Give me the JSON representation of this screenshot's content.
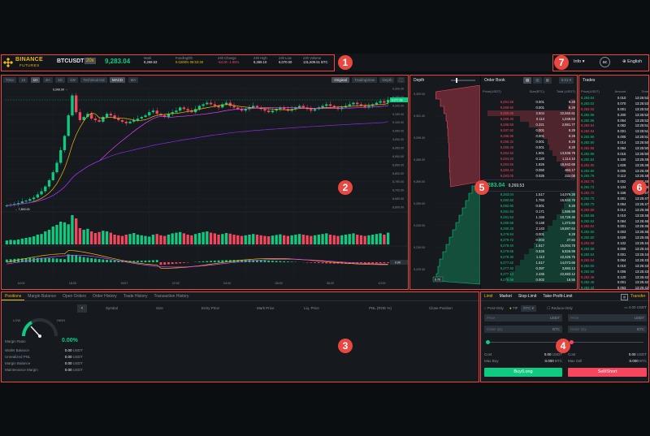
{
  "header": {
    "logo_top": "BINANCE",
    "logo_bottom": "FUTURES",
    "symbol": "BTCUSDT",
    "leverage": "20x",
    "last_price": "9,283.04",
    "stats": [
      {
        "label": "Mark",
        "value": "9,269.53"
      },
      {
        "label": "Funding/8h",
        "value": "0.0208%  05:53:28"
      },
      {
        "label": "24h Change",
        "value": "-54.00 -1.65%"
      },
      {
        "label": "24h High",
        "value": "9,369.10"
      },
      {
        "label": "24h Low",
        "value": "9,070.00"
      },
      {
        "label": "24h Volume",
        "value": "131,609.61 BTC"
      }
    ],
    "info": "Info",
    "avatar": "ac",
    "language": "English"
  },
  "chart_toolbar": {
    "time_buttons": [
      "Time",
      "15",
      "1H",
      "4H",
      "1D",
      "1W"
    ],
    "indicators": [
      "Technical Ind",
      "MACD",
      "MA"
    ],
    "view_buttons": [
      "Original",
      "TradingView",
      "Depth"
    ]
  },
  "chart_data": {
    "type": "candlestick",
    "price_axis": [
      "9,300.00",
      "9,250.00",
      "9,200.00",
      "9,150.00",
      "9,100.00",
      "9,050.00",
      "9,000.00",
      "8,950.00",
      "8,900.00",
      "8,850.00",
      "8,800.00",
      "8,750.00",
      "8,700.00",
      "8,650.00",
      "8,600.00"
    ],
    "ylim": [
      8600,
      9350
    ],
    "high_label": "9,306.00",
    "low_label": "7,800.00",
    "current_label": "9,277.69",
    "macd_label": "0.00",
    "time_axis": [
      "16:00",
      "18:00",
      "19/27",
      "22:00",
      "04:00",
      "06:00",
      "08:00",
      "10:00"
    ],
    "close": [
      8610,
      8615,
      8620,
      8625,
      8635,
      8640,
      8650,
      8660,
      8680,
      8700,
      8730,
      8770,
      8820,
      8880,
      8960,
      9050,
      9180,
      9306,
      9200,
      9150,
      9170,
      9190,
      9160,
      9150,
      9140,
      9170,
      9190,
      9180,
      9160,
      9150,
      9140,
      9130,
      9140,
      9150,
      9160,
      9170,
      9180,
      9200,
      9210,
      9190,
      9180,
      9170,
      9190,
      9200,
      9210,
      9230,
      9220,
      9210,
      9200,
      9220,
      9240,
      9250,
      9260,
      9250,
      9240,
      9230,
      9250,
      9260,
      9240,
      9230,
      9220,
      9210,
      9220,
      9230,
      9240,
      9230,
      9220,
      9210,
      9200,
      9210,
      9220,
      9230,
      9220,
      9210,
      9220,
      9230,
      9240,
      9230,
      9220,
      9210,
      9220,
      9230,
      9240,
      9250,
      9240,
      9230,
      9220,
      9230,
      9240,
      9250,
      9260,
      9250,
      9240,
      9230,
      9240,
      9250,
      9260,
      9270,
      9260,
      9278
    ],
    "volume": [
      12,
      14,
      13,
      15,
      18,
      20,
      22,
      25,
      30,
      32,
      40,
      45,
      55,
      60,
      70,
      68,
      62,
      90,
      80,
      50,
      45,
      48,
      40,
      35,
      38,
      42,
      40,
      36,
      30,
      28,
      26,
      30,
      32,
      35,
      30,
      28,
      26,
      24,
      30,
      32,
      28,
      26,
      30,
      34,
      36,
      38,
      34,
      30,
      28,
      32,
      35,
      38,
      40,
      36,
      34,
      30,
      32,
      35,
      33,
      30,
      28,
      26,
      28,
      30,
      32,
      30,
      28,
      26,
      25,
      27,
      29,
      31,
      28,
      26,
      28,
      30,
      32,
      30,
      28,
      26,
      28,
      30,
      32,
      34,
      30,
      28,
      26,
      28,
      30,
      32,
      34,
      30,
      28,
      26,
      28,
      30,
      32,
      34,
      30,
      36
    ]
  },
  "bottom_tabs": [
    "Positions",
    "Margin Balance",
    "Open Orders",
    "Order History",
    "Trade History",
    "Transaction History"
  ],
  "positions_columns": [
    "Symbol",
    "Size",
    "Entry Price",
    "Mark Price",
    "Liq. Price",
    "PNL (ROE %)",
    "Close Position"
  ],
  "margin": {
    "low": "LOW",
    "high": "HIGH",
    "ratio_label": "Margin Ratio",
    "ratio_value": "0.00%",
    "rows": [
      {
        "label": "Wallet Balance",
        "value": "0.00",
        "unit": "USDT"
      },
      {
        "label": "Unrealized PNL",
        "value": "0.00",
        "unit": "USDT"
      },
      {
        "label": "Margin Balance",
        "value": "0.00",
        "unit": "USDT"
      },
      {
        "label": "Maintenance Margin",
        "value": "0.00",
        "unit": "USDT"
      }
    ]
  },
  "depth": {
    "title": "Depth",
    "axis": [
      "9,309.00",
      "9,301.40",
      "9,299.00",
      "9,289.00",
      "9,269.00",
      "9,259.00",
      "9,249.00",
      "9,239.00",
      "9,229.00"
    ],
    "tag": "0.70"
  },
  "orderbook": {
    "title": "Order Book",
    "precision": "0.01",
    "columns": [
      "Price(USDT)",
      "Size(BTC)",
      "Total (USDT)"
    ],
    "asks": [
      {
        "p": "9,291.58",
        "s": "0.001",
        "t": "9.29",
        "d": 0.05
      },
      {
        "p": "9,289.92",
        "s": "0.001",
        "t": "9.29",
        "d": 0.08
      },
      {
        "p": "9,289.66",
        "s": "3.504",
        "t": "32,550.61",
        "d": 0.95
      },
      {
        "p": "9,289.40",
        "s": "0.113",
        "t": "1,049.63",
        "d": 0.6
      },
      {
        "p": "9,288.58",
        "s": "0.321",
        "t": "2,981.77",
        "d": 0.5
      },
      {
        "p": "9,287.92",
        "s": "0.001",
        "t": "9.29",
        "d": 0.4
      },
      {
        "p": "9,286.96",
        "s": "0.001",
        "t": "9.29",
        "d": 0.35
      },
      {
        "p": "9,286.32",
        "s": "0.001",
        "t": "9.29",
        "d": 0.3
      },
      {
        "p": "9,285.49",
        "s": "0.001",
        "t": "9.28",
        "d": 0.28
      },
      {
        "p": "9,284.92",
        "s": "1.501",
        "t": "13,936.78",
        "d": 0.25
      },
      {
        "p": "9,284.20",
        "s": "0.120",
        "t": "1,114.10",
        "d": 0.2
      },
      {
        "p": "9,283.66",
        "s": "1.825",
        "t": "16,942.68",
        "d": 0.15
      },
      {
        "p": "9,283.42",
        "s": "0.050",
        "t": "464.17",
        "d": 0.1
      },
      {
        "p": "9,283.05",
        "s": "0.025",
        "t": "232.08",
        "d": 0.05
      }
    ],
    "mid_price": "9,283.04",
    "mid_mark": "9,269.53",
    "bids": [
      {
        "p": "9,283.04",
        "s": "1.517",
        "t": "14,079.28",
        "d": 0.05
      },
      {
        "p": "9,282.62",
        "s": "1.793",
        "t": "16,643.76",
        "d": 0.1
      },
      {
        "p": "9,282.60",
        "s": "0.001",
        "t": "9.28",
        "d": 0.12
      },
      {
        "p": "9,281.94",
        "s": "0.171",
        "t": "1,586.99",
        "d": 0.15
      },
      {
        "p": "9,281.54",
        "s": "1.156",
        "t": "10,729.46",
        "d": 0.2
      },
      {
        "p": "9,280.68",
        "s": "0.148",
        "t": "1,373.65",
        "d": 0.25
      },
      {
        "p": "9,280.28",
        "s": "2.143",
        "t": "19,887.64",
        "d": 0.3
      },
      {
        "p": "9,279.94",
        "s": "0.001",
        "t": "9.28",
        "d": 0.35
      },
      {
        "p": "9,279.72",
        "s": "0.003",
        "t": "27.84",
        "d": 0.4
      },
      {
        "p": "9,279.40",
        "s": "1.617",
        "t": "15,004.78",
        "d": 0.45
      },
      {
        "p": "9,278.66",
        "s": "0.628",
        "t": "5,826.99",
        "d": 0.5
      },
      {
        "p": "9,278.30",
        "s": "1.113",
        "t": "10,326.75",
        "d": 0.55
      },
      {
        "p": "9,277.62",
        "s": "1.517",
        "t": "14,073.66",
        "d": 0.6
      },
      {
        "p": "9,277.40",
        "s": "0.397",
        "t": "3,683.13",
        "d": 0.65
      },
      {
        "p": "9,277.14",
        "s": "2.445",
        "t": "22,683.12",
        "d": 0.7
      },
      {
        "p": "9,276.58",
        "s": "0.002",
        "t": "18.55",
        "d": 0.75
      }
    ]
  },
  "trades": {
    "title": "Trades",
    "columns": [
      "Price(USDT)",
      "Amount",
      "Time"
    ],
    "rows": [
      {
        "p": "9,283.04",
        "a": "0.010",
        "t": "13:25:53",
        "c": "g"
      },
      {
        "p": "9,283.02",
        "a": "0.070",
        "t": "13:25:53",
        "c": "g"
      },
      {
        "p": "9,283.02",
        "a": "0.001",
        "t": "13:25:52",
        "c": "r"
      },
      {
        "p": "9,282.96",
        "a": "0.200",
        "t": "13:25:52",
        "c": "g"
      },
      {
        "p": "9,282.96",
        "a": "0.064",
        "t": "13:25:52",
        "c": "g"
      },
      {
        "p": "9,282.94",
        "a": "0.082",
        "t": "13:25:51",
        "c": "r"
      },
      {
        "p": "9,282.94",
        "a": "0.001",
        "t": "13:25:51",
        "c": "r"
      },
      {
        "p": "9,282.90",
        "a": "0.005",
        "t": "13:25:51",
        "c": "g"
      },
      {
        "p": "9,282.90",
        "a": "0.014",
        "t": "13:25:50",
        "c": "g"
      },
      {
        "p": "9,282.86",
        "a": "0.064",
        "t": "13:25:50",
        "c": "r"
      },
      {
        "p": "9,282.86",
        "a": "0.015",
        "t": "13:25:50",
        "c": "g"
      },
      {
        "p": "9,282.84",
        "a": "0.100",
        "t": "13:25:49",
        "c": "g"
      },
      {
        "p": "9,282.80",
        "a": "1.628",
        "t": "13:25:49",
        "c": "r"
      },
      {
        "p": "9,282.80",
        "a": "0.005",
        "t": "13:25:49",
        "c": "g"
      },
      {
        "p": "9,282.76",
        "a": "0.112",
        "t": "13:25:48",
        "c": "g"
      },
      {
        "p": "9,282.76",
        "a": "0.002",
        "t": "13:25:48",
        "c": "r"
      },
      {
        "p": "9,282.72",
        "a": "0.104",
        "t": "13:25:48",
        "c": "g"
      },
      {
        "p": "9,282.72",
        "a": "0.156",
        "t": "13:25:47",
        "c": "r"
      },
      {
        "p": "9,282.70",
        "a": "0.001",
        "t": "13:25:47",
        "c": "g"
      },
      {
        "p": "9,282.70",
        "a": "0.064",
        "t": "13:25:47",
        "c": "g"
      },
      {
        "p": "9,282.66",
        "a": "0.014",
        "t": "13:25:46",
        "c": "r"
      },
      {
        "p": "9,282.66",
        "a": "0.010",
        "t": "13:25:46",
        "c": "g"
      },
      {
        "p": "9,282.62",
        "a": "0.064",
        "t": "13:25:46",
        "c": "g"
      },
      {
        "p": "9,282.62",
        "a": "0.001",
        "t": "13:25:45",
        "c": "r"
      },
      {
        "p": "9,282.60",
        "a": "0.003",
        "t": "13:25:45",
        "c": "g"
      },
      {
        "p": "9,282.60",
        "a": "0.028",
        "t": "13:25:45",
        "c": "g"
      },
      {
        "p": "9,282.58",
        "a": "0.102",
        "t": "13:25:44",
        "c": "r"
      },
      {
        "p": "9,282.58",
        "a": "0.009",
        "t": "13:25:44",
        "c": "g"
      },
      {
        "p": "9,282.54",
        "a": "0.001",
        "t": "13:25:44",
        "c": "g"
      },
      {
        "p": "9,282.54",
        "a": "0.064",
        "t": "13:25:43",
        "c": "r"
      },
      {
        "p": "9,282.50",
        "a": "0.010",
        "t": "13:25:43",
        "c": "g"
      },
      {
        "p": "9,282.50",
        "a": "0.006",
        "t": "13:25:43",
        "c": "g"
      },
      {
        "p": "9,282.46",
        "a": "0.120",
        "t": "13:25:42",
        "c": "r"
      },
      {
        "p": "9,282.46",
        "a": "0.001",
        "t": "13:25:42",
        "c": "g"
      },
      {
        "p": "9,282.42",
        "a": "0.053",
        "t": "13:25:42",
        "c": "g"
      },
      {
        "p": "9,282.42",
        "a": "0.001",
        "t": "13:25:41",
        "c": "r"
      }
    ]
  },
  "order_form": {
    "tabs": [
      "Limit",
      "Market",
      "Stop-Limit",
      "Take-Profit-Limit"
    ],
    "transfer": "Transfer",
    "post_only": "Post-Only",
    "tif": "TIF",
    "gtc": "GTC",
    "reduce_only": "Reduce-Only",
    "available": "4.00 USDT",
    "price_label": "Price",
    "qty_label": "Order Qty",
    "unit_quote": "USDT",
    "unit_base": "BTC",
    "cost_label": "Cost",
    "cost_value": "0.00",
    "max_buy_label": "Max Buy",
    "max_buy_value": "0.000",
    "max_sell_label": "Max Sell",
    "max_sell_value": "0.000",
    "buy_label": "Buy/Long",
    "sell_label": "Sell/Short"
  },
  "annotations": [
    "1",
    "2",
    "3",
    "4",
    "5",
    "6",
    "7"
  ]
}
